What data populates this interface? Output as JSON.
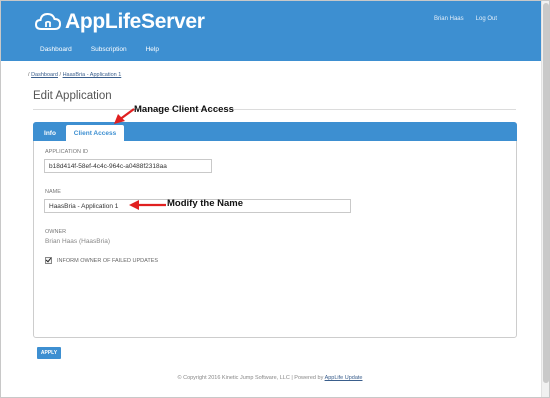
{
  "brand": {
    "name": "AppLifeServer",
    "primary_color": "#3d8fd1",
    "logo_icon": "cloud-icon"
  },
  "user_links": {
    "user": "Brian Haas",
    "logout": "Log Out"
  },
  "nav": {
    "items": [
      "Dashboard",
      "Subscription",
      "Help"
    ]
  },
  "breadcrumb": {
    "prefix": "/",
    "home": "Dashboard",
    "separator": "/",
    "current": "HaasBria - Application 1"
  },
  "page": {
    "title": "Edit Application"
  },
  "tabs": [
    {
      "label": "Info",
      "active": false
    },
    {
      "label": "Client Access",
      "active": true
    }
  ],
  "form": {
    "app_id_label": "APPLICATION ID",
    "app_id_value": "b18d414f-58ef-4c4c-964c-a0488f2318aa",
    "name_label": "NAME",
    "name_value": "HaasBria - Application 1",
    "owner_label": "OWNER",
    "owner_value": "Brian Haas (HaasBria)",
    "inform_label": "INFORM OWNER OF FAILED UPDATES",
    "inform_checked": true,
    "apply_label": "APPLY"
  },
  "footer": {
    "text": "© Copyright 2016 Kinetic Jump Software, LLC | Powered by",
    "link": "AppLife Update"
  },
  "annotations": {
    "manage": "Manage Client Access",
    "modify": "Modify the Name",
    "arrow_color": "#e02020"
  }
}
